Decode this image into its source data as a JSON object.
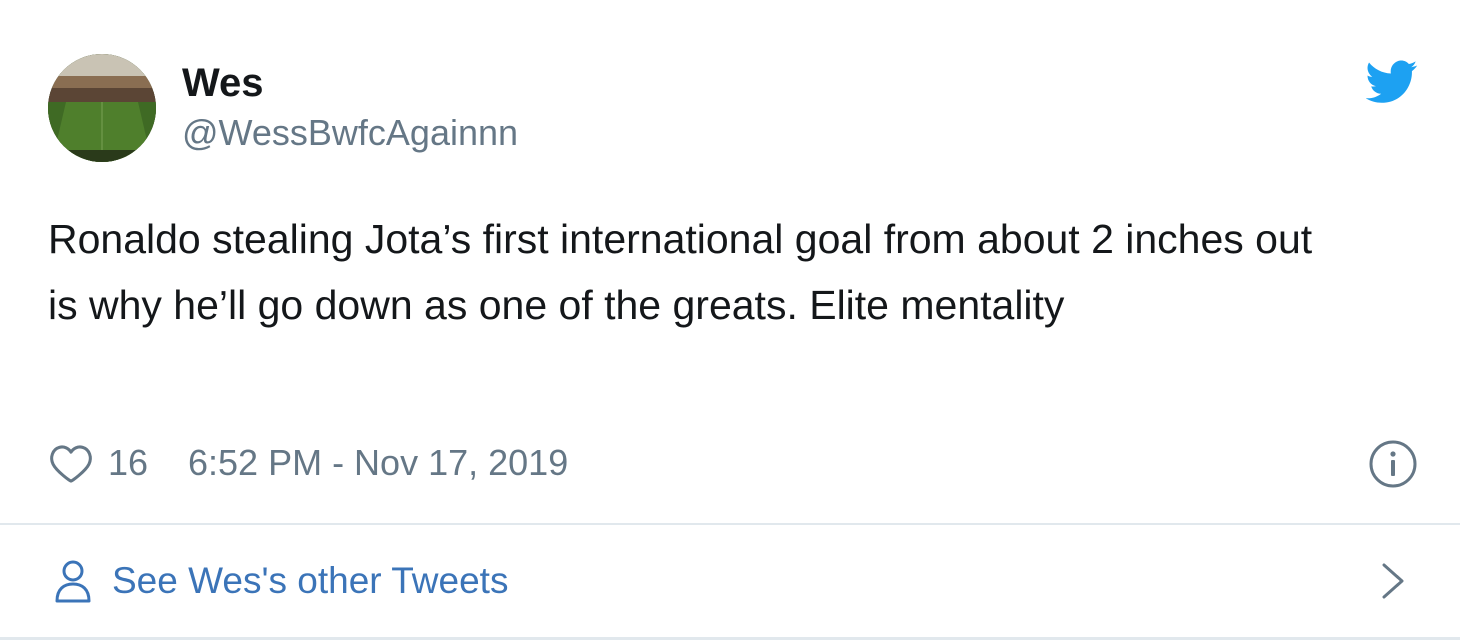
{
  "user": {
    "display_name": "Wes",
    "handle": "@WessBwfcAgainnn",
    "avatar_icon": "stadium-pitch-avatar"
  },
  "tweet": {
    "text": "Ronaldo stealing Jota’s first international goal from about 2 inches out is why he’ll go down as one of the greats. Elite mentality",
    "likes": "16",
    "timestamp": "6:52 PM - Nov 17, 2019"
  },
  "footer": {
    "label": "See Wes's other Tweets"
  },
  "icons": {
    "brand": "twitter-bird-icon",
    "like": "heart-icon",
    "info": "info-icon",
    "profile": "person-icon",
    "next": "chevron-right-icon"
  },
  "colors": {
    "brand_blue": "#1da1f2",
    "link_blue": "#3b74b8",
    "secondary_text": "#657786",
    "primary_text": "#14171a",
    "divider": "#e1e8ed"
  }
}
